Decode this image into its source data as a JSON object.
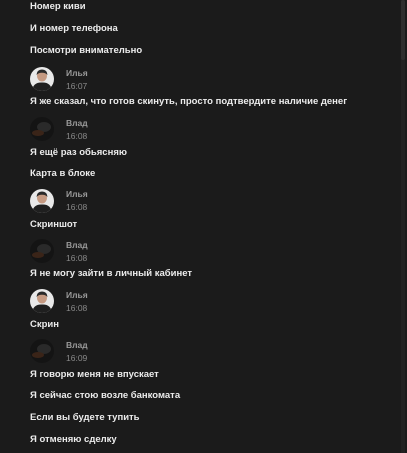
{
  "messages_top": [
    {
      "text": "Номер киви"
    },
    {
      "text": "И номер телефона"
    },
    {
      "text": "Посмотри внимательно"
    }
  ],
  "groups": [
    {
      "author": "Илья",
      "time": "16:07",
      "avatar": "ilya-photo",
      "lines": [
        "Я же сказал, что готов скинуть, просто подтвердите наличие денег"
      ]
    },
    {
      "author": "Влад",
      "time": "16:08",
      "avatar": "vlad-photo",
      "lines": [
        "Я ещё раз обьясняю",
        "Карта в блоке"
      ]
    },
    {
      "author": "Илья",
      "time": "16:08",
      "avatar": "ilya-photo",
      "lines": [
        "Скриншот"
      ]
    },
    {
      "author": "Влад",
      "time": "16:08",
      "avatar": "vlad-photo",
      "lines": [
        "Я не могу зайти в личный кабинет"
      ]
    },
    {
      "author": "Илья",
      "time": "16:08",
      "avatar": "ilya-photo",
      "lines": [
        "Скрин"
      ]
    },
    {
      "author": "Влад",
      "time": "16:09",
      "avatar": "vlad-photo",
      "lines": [
        "Я говорю меня не впускает",
        "Я сейчас стою возле банкомата",
        "Если вы будете тупить",
        "Я отменяю сделку"
      ]
    }
  ]
}
